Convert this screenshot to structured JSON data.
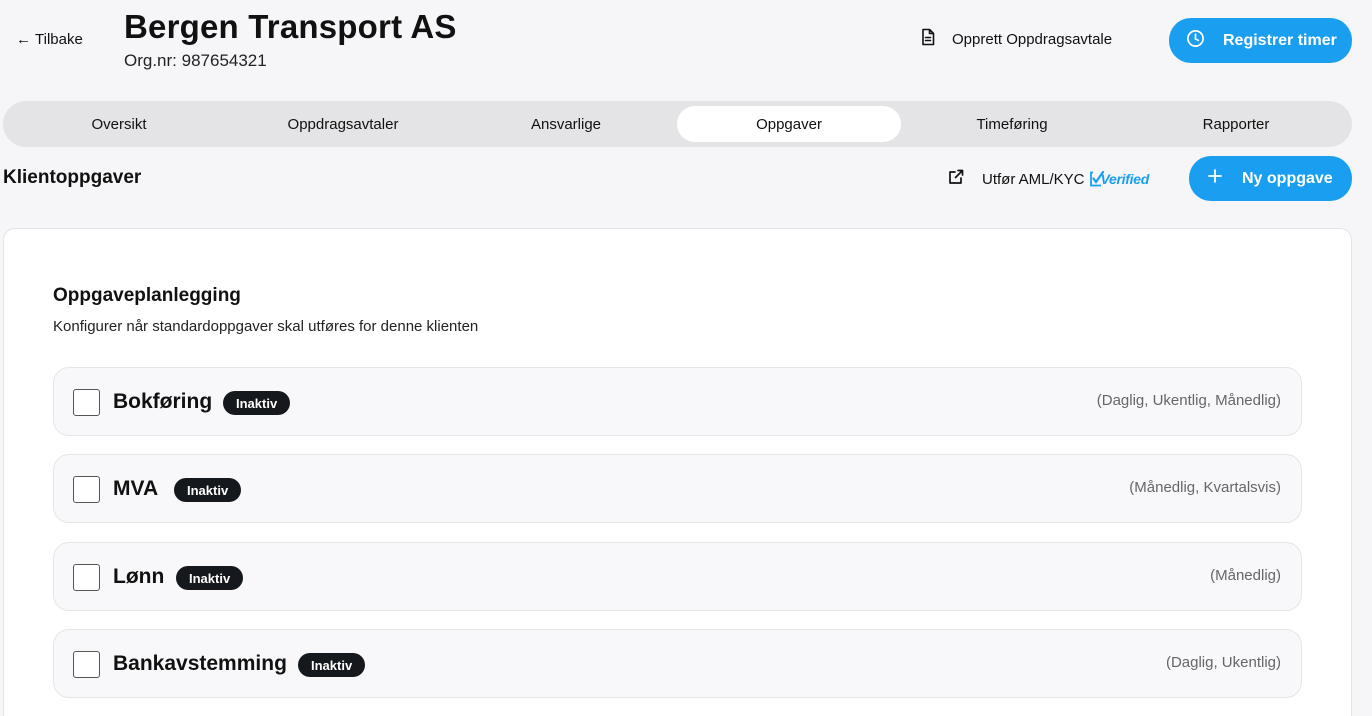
{
  "header": {
    "back_label": "Tilbake",
    "client_name": "Bergen Transport AS",
    "org_nr": "Org.nr: 987654321",
    "doc_button_label": "Opprett Oppdragsavtale",
    "register_button_label": "Registrer timer"
  },
  "tabs": [
    "Oversikt",
    "Oppdragsavtaler",
    "Ansvarlige",
    "Oppgaver",
    "Timeføring",
    "Rapporter"
  ],
  "active_tab": "Oppgaver",
  "section": {
    "title": "Klientoppgaver",
    "aml_label": "Utfør AML/KYC",
    "verified_logo": "Verified",
    "new_button_label": "Ny oppgave"
  },
  "planning": {
    "title": "Oppgaveplanlegging",
    "description": "Konfigurer når standardoppgaver skal utføres for denne klienten",
    "tasks": [
      {
        "name": "Bokføring",
        "status": "Inaktiv",
        "frequency": "(Daglig, Ukentlig, Månedlig)",
        "checked": false
      },
      {
        "name": "MVA",
        "status": "Inaktiv",
        "frequency": "(Månedlig, Kvartalsvis)",
        "checked": false
      },
      {
        "name": "Lønn",
        "status": "Inaktiv",
        "frequency": "(Månedlig)",
        "checked": false
      },
      {
        "name": "Bankavstemming",
        "status": "Inaktiv",
        "frequency": "(Daglig, Ukentlig)",
        "checked": false
      }
    ]
  },
  "colors": {
    "accent": "#1a9ff0",
    "badge_bg": "#15181c",
    "page_bg": "#f6f6f9",
    "tabbar_bg": "#e4e4e6"
  },
  "icons": {
    "back": "arrow-left-icon",
    "document": "document-icon",
    "clock": "clock-icon",
    "external": "external-link-icon",
    "plus": "plus-icon"
  }
}
